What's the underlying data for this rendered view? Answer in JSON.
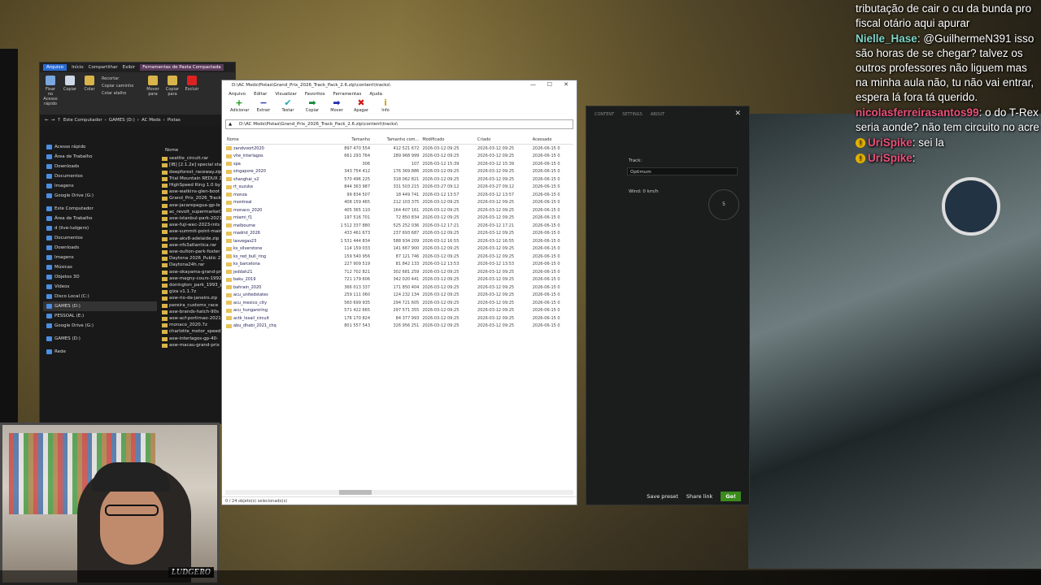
{
  "chat": {
    "messages": [
      {
        "user": "",
        "text": "tributação de cair o cu da bunda pro fiscal otário aqui apurar"
      },
      {
        "user": "Nielle_Hase",
        "text": ": @GuilhermeN391 isso são horas de se chegar? talvez os outros professores não liguem mas na minha aula não, tu não vai entrar, espera lá fora tá querido."
      },
      {
        "user": "nicolasferreirasantos99",
        "text": ": o do T-Rex seria aonde? não tem circuito no acre"
      },
      {
        "user": "UriSpike",
        "text": ": sei la"
      },
      {
        "user": "UriSpike",
        "text": ":"
      }
    ]
  },
  "explorer": {
    "tabs": [
      "Arquivo",
      "Início",
      "Compartilhar",
      "Exibir",
      "Ferramentas de Pasta Compactada"
    ],
    "extract_tab": "Extrair",
    "ribbon": [
      "Fixar no Acesso rápido",
      "Copiar",
      "Colar",
      "Mover para",
      "Copiar para",
      "Excluir",
      "Renomear"
    ],
    "ribbon_small": [
      "Recortar",
      "Copiar caminho",
      "Colar atalho"
    ],
    "section": "Área de Transferência",
    "organize": "Organizar",
    "address": [
      "Este Computador",
      "GAMES (D:)",
      "AC Mods",
      "Pistas"
    ],
    "nav": [
      "Acesso rápido",
      "Área de Trabalho",
      "Downloads",
      "Documentos",
      "Imagens",
      "Google Drive (G:)",
      "Este Computador",
      "Área de Trabalho",
      "d (live-ludgero)",
      "Documentos",
      "Downloads",
      "Imagens",
      "Músicas",
      "Objetos 3D",
      "Vídeos",
      "Disco Local (C:)",
      "GAMES (D:)",
      "PESSOAL (E:)",
      "Google Drive (G:)",
      "GAMES (D:)",
      "Rede"
    ],
    "files_header": "Nome",
    "files": [
      "seattle_circuit.rar",
      "[IB] [2.1.2e] special stage",
      "deepforest_raceway.zip",
      "Trial Mountain REDUX 2",
      "HighSpeed Ring 1.0 by",
      "asw-watkins-glen-boot",
      "Grand_Prix_2026_Track",
      "asw-jacarepagua-gp-le",
      "ac_revolt_supermarket1",
      "asw-istanbul-park-2021",
      "asw-fuji-wec-2023-ints",
      "asw-summit-point-main",
      "asw-akv8-adelaide.zip",
      "asw-nfs3atlantica.rar",
      "asw-oulton-park-foster",
      "Daytona 2026_Public 2",
      "Daytona24h.rar",
      "asw-okayama-grand-pr",
      "asw-magny-cours-1992",
      "donington_park_1993_p",
      "giza v1.1.7z",
      "asw-rio-de-janeiro.zip",
      "pereira_customs_race",
      "asw-brands-hatch-90s",
      "asw-acf-portimao-2021",
      "monaco_2020.7z",
      "charlotte_motor_speed",
      "asw-interlagos-gp-40-",
      "asw-macau-grand-prix"
    ]
  },
  "zip": {
    "title": "D:\\AC Mods\\Pistas\\Grand_Prix_2026_Track_Pack_2.6.zip\\content\\tracks\\",
    "menu": [
      "Arquivo",
      "Editar",
      "Visualizar",
      "Favoritos",
      "Ferramentas",
      "Ajuda"
    ],
    "tools": [
      {
        "label": "Adicionar",
        "glyph": "+",
        "color": "#1a9a1a"
      },
      {
        "label": "Extrair",
        "glyph": "−",
        "color": "#1a2fb0"
      },
      {
        "label": "Testar",
        "glyph": "✔",
        "color": "#1fa7b0"
      },
      {
        "label": "Copiar",
        "glyph": "➡",
        "color": "#128a36"
      },
      {
        "label": "Mover",
        "glyph": "➡",
        "color": "#1a2fb0"
      },
      {
        "label": "Apagar",
        "glyph": "✖",
        "color": "#d01a1a"
      },
      {
        "label": "Info",
        "glyph": "i",
        "color": "#d6a400"
      }
    ],
    "address": "D:\\AC Mods\\Pistas\\Grand_Prix_2026_Track_Pack_2.6.zip\\content\\tracks\\",
    "columns": [
      "Nome",
      "Tamanho",
      "Tamanho com...",
      "Modificado",
      "Criado",
      "Acessado"
    ],
    "rows": [
      [
        "zandvoort2020",
        "897 470 554",
        "412 521 672",
        "2026-03-12 09:25",
        "2026-03-12 09:25",
        "2026-06-15 0"
      ],
      [
        "vhe_interlagos",
        "661 293 764",
        "289 968 999",
        "2026-03-12 09:25",
        "2026-03-12 09:25",
        "2026-06-15 0"
      ],
      [
        "spa",
        "306",
        "107",
        "2026-03-12 15:39",
        "2026-03-12 15:39",
        "2026-06-15 0"
      ],
      [
        "singapore_2020",
        "343 754 412",
        "176 369 886",
        "2026-03-12 09:25",
        "2026-03-12 09:25",
        "2026-06-15 0"
      ],
      [
        "shanghai_v2",
        "570 496 225",
        "318 062 821",
        "2026-03-12 09:25",
        "2026-03-12 09:25",
        "2026-06-15 0"
      ],
      [
        "rt_suzuka",
        "844 363 987",
        "331 503 215",
        "2026-03-27 09:12",
        "2026-03-27 09:12",
        "2026-06-15 0"
      ],
      [
        "monza",
        "99 834 507",
        "18 449 741",
        "2026-03-12 13:57",
        "2026-03-12 13:57",
        "2026-06-15 0"
      ],
      [
        "montreal",
        "408 159 465",
        "212 103 375",
        "2026-03-12 09:25",
        "2026-03-12 09:25",
        "2026-06-15 0"
      ],
      [
        "monaco_2020",
        "405 365 110",
        "164 407 161",
        "2026-03-12 09:25",
        "2026-03-12 09:25",
        "2026-06-15 0"
      ],
      [
        "miami_f1",
        "197 516 701",
        "72 850 834",
        "2026-03-12 09:25",
        "2026-03-12 09:25",
        "2026-06-15 0"
      ],
      [
        "melbourne",
        "1 512 337 880",
        "525 252 036",
        "2026-03-12 17:21",
        "2026-03-12 17:21",
        "2026-06-15 0"
      ],
      [
        "madrid_2026",
        "433 461 673",
        "237 693 687",
        "2026-03-12 09:25",
        "2026-03-12 09:25",
        "2026-06-15 0"
      ],
      [
        "lasvegas23",
        "1 531 444 834",
        "588 934 209",
        "2026-03-12 16:55",
        "2026-03-12 16:55",
        "2026-06-15 0"
      ],
      [
        "ks_silverstone",
        "114 159 033",
        "141 667 900",
        "2026-03-12 09:25",
        "2026-03-12 09:25",
        "2026-06-15 0"
      ],
      [
        "ks_red_bull_ring",
        "159 540 956",
        "87 121 746",
        "2026-03-12 09:25",
        "2026-03-12 09:25",
        "2026-06-15 0"
      ],
      [
        "ks_barcelona",
        "227 909 519",
        "81 842 133",
        "2026-03-12 13:53",
        "2026-03-12 13:53",
        "2026-06-15 0"
      ],
      [
        "jeddah21",
        "712 702 821",
        "302 681 259",
        "2026-03-12 09:25",
        "2026-03-12 09:25",
        "2026-06-15 0"
      ],
      [
        "baku_2019",
        "721 179 606",
        "342 020 441",
        "2026-03-12 09:25",
        "2026-03-12 09:25",
        "2026-06-15 0"
      ],
      [
        "bahrain_2020",
        "366 013 337",
        "171 850 404",
        "2026-03-12 09:25",
        "2026-03-12 09:25",
        "2026-06-15 0"
      ],
      [
        "acu_unitedstates",
        "259 111 060",
        "124 232 134",
        "2026-03-12 09:25",
        "2026-03-12 09:25",
        "2026-06-15 0"
      ],
      [
        "acu_mexico_city",
        "560 699 935",
        "294 721 605",
        "2026-03-12 09:25",
        "2026-03-12 09:25",
        "2026-06-15 0"
      ],
      [
        "acu_hungaroring",
        "571 422 665",
        "297 571 355",
        "2026-03-12 09:25",
        "2026-03-12 09:25",
        "2026-06-15 0"
      ],
      [
        "actk_losail_circuit",
        "176 170 824",
        "84 377 993",
        "2026-03-12 09:25",
        "2026-03-12 09:25",
        "2026-06-15 0"
      ],
      [
        "abu_dhabi_2021_chq",
        "801 557 543",
        "326 956 251",
        "2026-03-12 09:25",
        "2026-03-12 09:25",
        "2026-06-15 0"
      ]
    ],
    "status": "0 / 24 objeto(s) selecionado(s)"
  },
  "content_manager": {
    "tabs": [
      "CONTENT",
      "SETTINGS",
      "ABOUT"
    ],
    "track_label": "Track:",
    "track_value": "Optimum",
    "wind": "Wind: 0 km/h",
    "wind_value": "5",
    "save_preset": "Save preset",
    "share_link": "Share link",
    "go": "Go!"
  },
  "webcam": {
    "logo": "LUDGERO"
  }
}
